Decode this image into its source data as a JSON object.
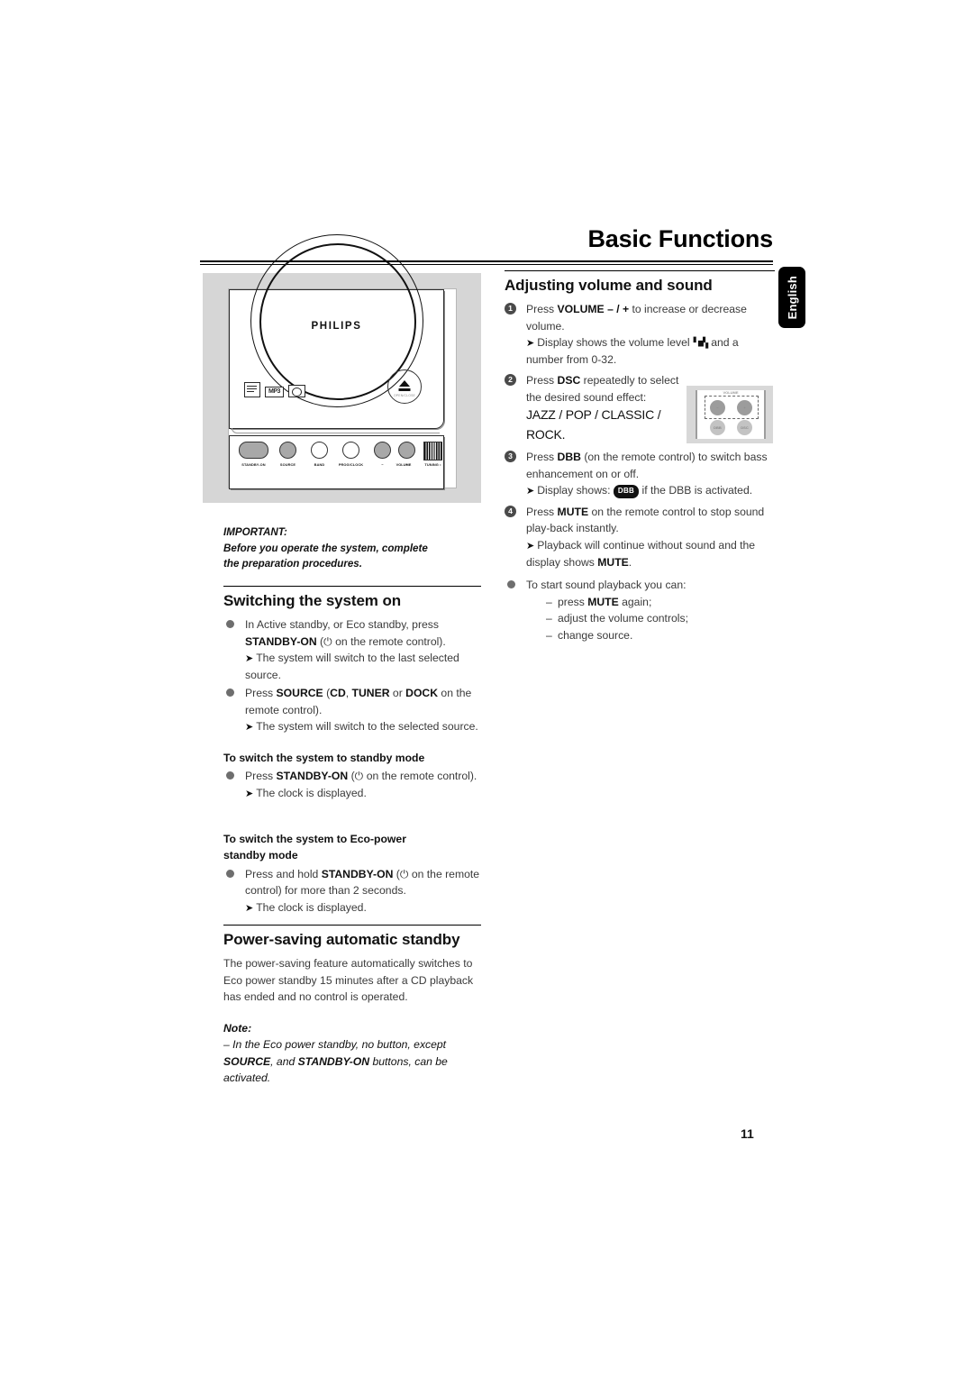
{
  "header": {
    "title": "Basic Functions",
    "language_tab": "English",
    "page_number": "11"
  },
  "product_image": {
    "brand": "PHILIPS",
    "logos": [
      "cd-rw-icon",
      "mp3-logo",
      "cd-digital-audio-logo"
    ],
    "eject_label": "OPEN/CLOSE",
    "buttons": [
      {
        "name": "standby-on",
        "label": "STANDBY-ON"
      },
      {
        "name": "source",
        "label": "SOURCE"
      },
      {
        "name": "band",
        "label": "BAND"
      },
      {
        "name": "prog-clock",
        "label": "PROG/CLOCK"
      },
      {
        "name": "volume-minus",
        "label": "−"
      },
      {
        "name": "volume",
        "label": "VOLUME"
      },
      {
        "name": "volume-plus",
        "label": "+"
      },
      {
        "name": "tuning",
        "label": "TUNING •"
      }
    ]
  },
  "remote_inset": {
    "caption": "VOLUME",
    "buttons": [
      {
        "name": "volume-minus",
        "label": "−"
      },
      {
        "name": "volume-plus",
        "label": "+"
      },
      {
        "name": "dbb",
        "label": "DBB"
      },
      {
        "name": "dsc",
        "label": "DSC"
      }
    ]
  },
  "left_column": {
    "important": {
      "heading": "IMPORTANT:",
      "line1": "Before you operate the system, complete",
      "line2": "the preparation procedures."
    },
    "switching_on": {
      "heading": "Switching the system on",
      "items": [
        {
          "marker": "bullet",
          "parts": [
            {
              "t": "In Active standby, or Eco standby, press "
            },
            {
              "t": "STANDBY-ON",
              "b": true
            },
            {
              "t": " (⏻ on the remote control)."
            }
          ],
          "result": "The system will switch to the last selected source."
        },
        {
          "marker": "bullet",
          "parts": [
            {
              "t": "Press "
            },
            {
              "t": "SOURCE",
              "b": true
            },
            {
              "t": " ("
            },
            {
              "t": "CD",
              "b": true
            },
            {
              "t": ", "
            },
            {
              "t": "TUNER",
              "b": true
            },
            {
              "t": " or "
            },
            {
              "t": "DOCK",
              "b": true
            },
            {
              "t": " on the remote control)."
            }
          ],
          "result": "The system will switch to the selected source."
        }
      ]
    },
    "standby_mode": {
      "heading": "To switch the system to standby mode",
      "parts": [
        {
          "t": "Press "
        },
        {
          "t": "STANDBY-ON",
          "b": true
        },
        {
          "t": " (⏻ on the remote control)."
        }
      ],
      "result": "The clock is displayed."
    },
    "eco_standby_mode": {
      "heading_line1": "To switch the system to Eco-power",
      "heading_line2": "standby mode",
      "parts": [
        {
          "t": "Press and hold "
        },
        {
          "t": "STANDBY-ON",
          "b": true
        },
        {
          "t": " (⏻ on the remote control) for more than 2 seconds."
        }
      ],
      "result": "The clock is displayed."
    },
    "power_saving": {
      "heading": "Power-saving automatic standby",
      "body": "The power-saving feature automatically switches to Eco power standby 15 minutes after a CD playback has ended and no control is operated.",
      "note_heading": "Note:",
      "note_parts": [
        {
          "t": "– In the Eco power standby, no button, except "
        },
        {
          "t": "SOURCE",
          "b": true
        },
        {
          "t": ", and "
        },
        {
          "t": "STANDBY-ON",
          "b": true
        },
        {
          "t": " buttons, can be activated."
        }
      ]
    }
  },
  "right_column": {
    "heading": "Adjusting volume and sound",
    "steps": [
      {
        "num": "1",
        "parts": [
          {
            "t": "Press "
          },
          {
            "t": "VOLUME – / +",
            "b": true
          },
          {
            "t": " to increase or decrease volume."
          }
        ],
        "results": [
          {
            "parts": [
              {
                "t": "Display shows the volume level "
              },
              {
                "t": "VOL",
                "glyph": "seg-display"
              },
              {
                "t": " and a number from 0-32."
              }
            ]
          }
        ]
      },
      {
        "num": "2",
        "parts": [
          {
            "t": "Press "
          },
          {
            "t": "DSC",
            "b": true
          },
          {
            "t": " repeatedly to select the desired sound effect:"
          }
        ],
        "effects_line1": "JAZZ / POP / CLASSIC /",
        "effects_line2": "ROCK."
      },
      {
        "num": "3",
        "parts": [
          {
            "t": "Press "
          },
          {
            "t": "DBB",
            "b": true
          },
          {
            "t": " (on the remote control) to switch bass enhancement on or off."
          }
        ],
        "results": [
          {
            "parts": [
              {
                "t": "Display shows: "
              },
              {
                "t": "DBB",
                "glyph": "badge"
              },
              {
                "t": " if the DBB is activated."
              }
            ]
          }
        ]
      },
      {
        "num": "4",
        "parts": [
          {
            "t": "Press "
          },
          {
            "t": "MUTE",
            "b": true
          },
          {
            "t": " on the remote control to stop sound play-back instantly."
          }
        ],
        "results": [
          {
            "parts": [
              {
                "t": "Playback will continue without sound and the display shows "
              },
              {
                "t": "MUTE",
                "b": true
              },
              {
                "t": "."
              }
            ]
          }
        ]
      }
    ],
    "start_playback": {
      "marker": "bullet",
      "lead": "To start sound playback you can:",
      "items": [
        [
          {
            "t": "press "
          },
          {
            "t": "MUTE",
            "b": true
          },
          {
            "t": " again;"
          }
        ],
        [
          {
            "t": "adjust the volume controls;"
          }
        ],
        [
          {
            "t": "change source."
          }
        ]
      ]
    }
  }
}
